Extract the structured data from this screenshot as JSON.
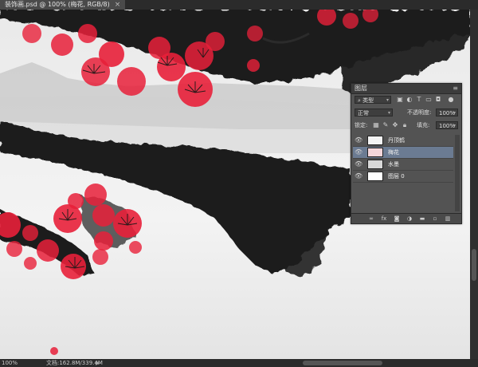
{
  "document_tab": {
    "title": "装饰画.psd @ 100% (梅花, RGB/8)",
    "close": "×"
  },
  "status_bar": {
    "zoom": "100%",
    "doc_info": "文档:162.8M/339.4M",
    "arrow": "▶"
  },
  "layers_panel": {
    "title": "图层",
    "menu": "≡",
    "filter": {
      "label": "类型",
      "icon": "search-icon"
    },
    "blend_mode": "正常",
    "opacity_label": "不透明度:",
    "opacity_value": "100%",
    "lock_label": "锁定:",
    "fill_label": "填充:",
    "fill_value": "100%",
    "layers": [
      {
        "name": "丹顶鹤",
        "visible": true,
        "active": false
      },
      {
        "name": "梅花",
        "visible": true,
        "active": true
      },
      {
        "name": "水墨",
        "visible": true,
        "active": false
      },
      {
        "name": "图层 0",
        "visible": true,
        "active": false
      }
    ],
    "footer_icons": [
      "link-icon",
      "fx-icon",
      "mask-icon",
      "adjustment-icon",
      "group-icon",
      "new-layer-icon",
      "trash-icon"
    ]
  },
  "colors": {
    "blossom": "#e8203a",
    "ink": "#1e1e1e",
    "selected_layer": "#6b7b92"
  }
}
